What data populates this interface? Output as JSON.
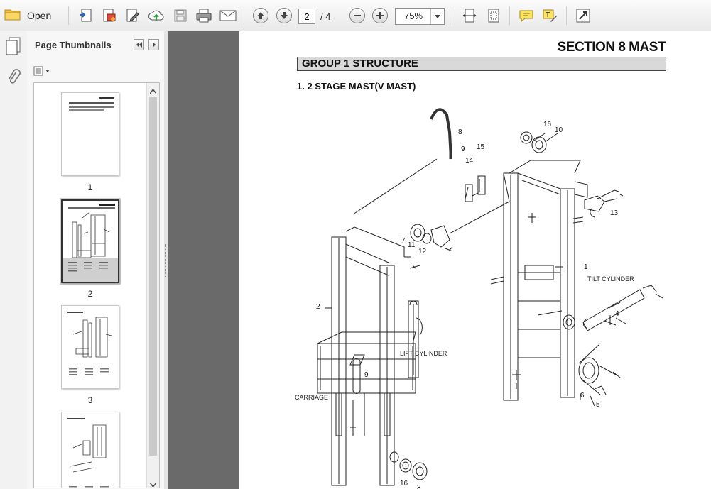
{
  "toolbar": {
    "open_label": "Open",
    "page_current": "2",
    "page_total_label": "/ 4",
    "zoom_value": "75%"
  },
  "panel": {
    "title": "Page Thumbnails",
    "thumbnails": [
      {
        "number": "1"
      },
      {
        "number": "2"
      },
      {
        "number": "3"
      }
    ]
  },
  "document": {
    "section_title": "SECTION 8 MAST",
    "group_title": "GROUP 1 STRUCTURE",
    "subtitle": "1. 2 STAGE MAST(V MAST)",
    "callouts": {
      "tilt_cylinder": "TILT CYLINDER",
      "lift_cylinder": "LIFT CYLINDER",
      "carriage": "CARRIAGE"
    },
    "part_numbers": [
      "16",
      "10",
      "8",
      "9",
      "15",
      "14",
      "13",
      "7",
      "11",
      "12",
      "1",
      "2",
      "4",
      "9",
      "6",
      "5",
      "16",
      "3"
    ]
  },
  "colors": {
    "viewer_gray": "#6a6a6a",
    "toolbar_bg": "#eeeeee",
    "group_bar_bg": "#d9d9d9"
  }
}
